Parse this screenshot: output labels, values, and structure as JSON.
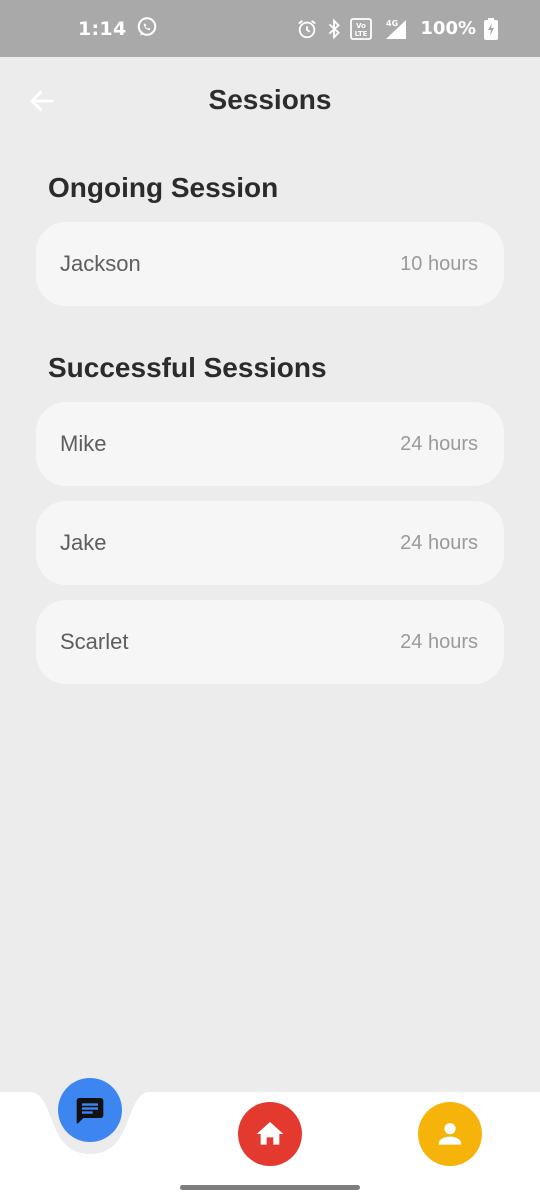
{
  "status_bar": {
    "time": "1:14",
    "network": "4G",
    "volte": "Vo LTE",
    "battery": "100%",
    "icons": [
      "whatsapp-icon",
      "alarm-icon",
      "bluetooth-icon",
      "volte-icon",
      "signal-icon",
      "battery-charging-icon"
    ]
  },
  "header": {
    "title": "Sessions",
    "back_icon": "arrow-left-icon"
  },
  "ongoing": {
    "heading": "Ongoing Session",
    "items": [
      {
        "name": "Jackson",
        "duration": "10 hours"
      }
    ]
  },
  "successful": {
    "heading": "Successful Sessions",
    "items": [
      {
        "name": "Mike",
        "duration": "24 hours"
      },
      {
        "name": "Jake",
        "duration": "24 hours"
      },
      {
        "name": "Scarlet",
        "duration": "24 hours"
      }
    ]
  },
  "bottom_nav": {
    "items": [
      {
        "icon": "chat-icon",
        "color": "#3d86f2",
        "active": true
      },
      {
        "icon": "home-icon",
        "color": "#e4392f",
        "active": false
      },
      {
        "icon": "profile-icon",
        "color": "#f6b40a",
        "active": false
      }
    ]
  },
  "colors": {
    "background": "#ececec",
    "card": "#f6f6f6",
    "status_bar": "#a9a9a9"
  }
}
